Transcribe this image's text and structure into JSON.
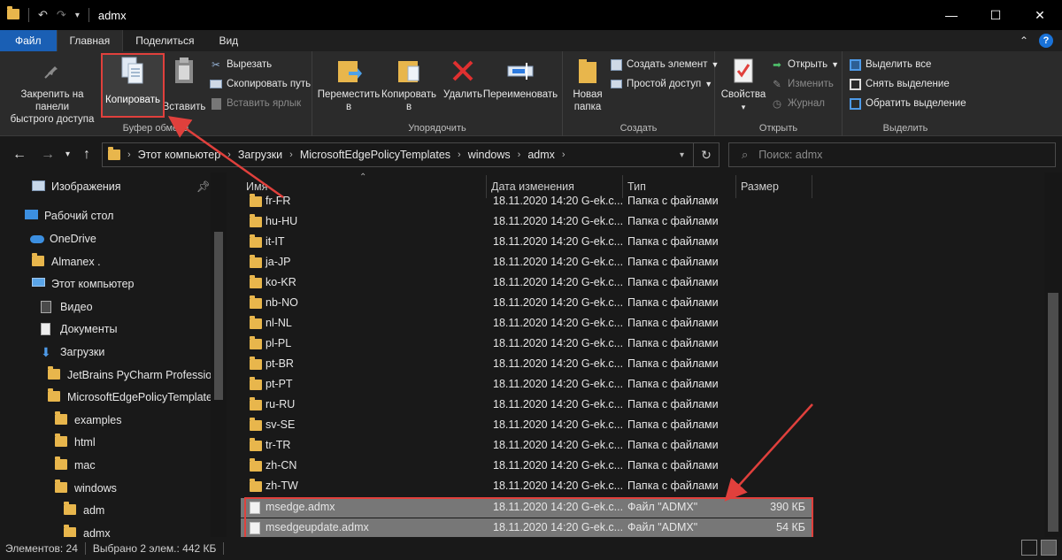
{
  "window": {
    "title": "admx"
  },
  "tabs": [
    {
      "label": "Файл"
    },
    {
      "label": "Главная"
    },
    {
      "label": "Поделиться"
    },
    {
      "label": "Вид"
    }
  ],
  "ribbon": {
    "clipboard": {
      "pin_label_1": "Закрепить на панели",
      "pin_label_2": "быстрого доступа",
      "copy": "Копировать",
      "paste": "Вставить",
      "cut": "Вырезать",
      "copy_path": "Скопировать путь",
      "paste_shortcut": "Вставить ярлык",
      "group": "Буфер обмена"
    },
    "organize": {
      "move_1": "Переместить",
      "move_2": "в",
      "copy_1": "Копировать",
      "copy_2": "в",
      "delete": "Удалить",
      "rename": "Переименовать",
      "group": "Упорядочить"
    },
    "create": {
      "new_folder_1": "Новая",
      "new_folder_2": "папка",
      "new_item": "Создать элемент",
      "easy_access": "Простой доступ",
      "group": "Создать"
    },
    "open": {
      "properties": "Свойства",
      "open": "Открыть",
      "edit": "Изменить",
      "history": "Журнал",
      "group": "Открыть"
    },
    "select": {
      "select_all": "Выделить все",
      "select_none": "Снять выделение",
      "invert": "Обратить выделение",
      "group": "Выделить"
    }
  },
  "address": {
    "crumbs": [
      "Этот компьютер",
      "Загрузки",
      "MicrosoftEdgePolicyTemplates",
      "windows",
      "admx"
    ],
    "search_placeholder": "Поиск: admx"
  },
  "nav_pane": {
    "items": [
      "Изображения",
      "Рабочий стол",
      "OneDrive",
      "Almanex .",
      "Этот компьютер",
      "Видео",
      "Документы",
      "Загрузки",
      "JetBrains PyCharm Profession",
      "MicrosoftEdgePolicyTemplate",
      "examples",
      "html",
      "mac",
      "windows",
      "adm",
      "admx"
    ]
  },
  "columns": {
    "name": "Имя",
    "date": "Дата изменения",
    "type": "Тип",
    "size": "Размер"
  },
  "files": [
    {
      "name": "fr-FR",
      "date": "18.11.2020 14:20 G-ek.c...",
      "type": "Папка с файлами",
      "size": ""
    },
    {
      "name": "hu-HU",
      "date": "18.11.2020 14:20 G-ek.c...",
      "type": "Папка с файлами",
      "size": ""
    },
    {
      "name": "it-IT",
      "date": "18.11.2020 14:20 G-ek.c...",
      "type": "Папка с файлами",
      "size": ""
    },
    {
      "name": "ja-JP",
      "date": "18.11.2020 14:20 G-ek.c...",
      "type": "Папка с файлами",
      "size": ""
    },
    {
      "name": "ko-KR",
      "date": "18.11.2020 14:20 G-ek.c...",
      "type": "Папка с файлами",
      "size": ""
    },
    {
      "name": "nb-NO",
      "date": "18.11.2020 14:20 G-ek.c...",
      "type": "Папка с файлами",
      "size": ""
    },
    {
      "name": "nl-NL",
      "date": "18.11.2020 14:20 G-ek.c...",
      "type": "Папка с файлами",
      "size": ""
    },
    {
      "name": "pl-PL",
      "date": "18.11.2020 14:20 G-ek.c...",
      "type": "Папка с файлами",
      "size": ""
    },
    {
      "name": "pt-BR",
      "date": "18.11.2020 14:20 G-ek.c...",
      "type": "Папка с файлами",
      "size": ""
    },
    {
      "name": "pt-PT",
      "date": "18.11.2020 14:20 G-ek.c...",
      "type": "Папка с файлами",
      "size": ""
    },
    {
      "name": "ru-RU",
      "date": "18.11.2020 14:20 G-ek.c...",
      "type": "Папка с файлами",
      "size": ""
    },
    {
      "name": "sv-SE",
      "date": "18.11.2020 14:20 G-ek.c...",
      "type": "Папка с файлами",
      "size": ""
    },
    {
      "name": "tr-TR",
      "date": "18.11.2020 14:20 G-ek.c...",
      "type": "Папка с файлами",
      "size": ""
    },
    {
      "name": "zh-CN",
      "date": "18.11.2020 14:20 G-ek.c...",
      "type": "Папка с файлами",
      "size": ""
    },
    {
      "name": "zh-TW",
      "date": "18.11.2020 14:20 G-ek.c...",
      "type": "Папка с файлами",
      "size": ""
    },
    {
      "name": "msedge.admx",
      "date": "18.11.2020 14:20 G-ek.c...",
      "type": "Файл \"ADMX\"",
      "size": "390 КБ"
    },
    {
      "name": "msedgeupdate.admx",
      "date": "18.11.2020 14:20 G-ek.c...",
      "type": "Файл \"ADMX\"",
      "size": "54 КБ"
    }
  ],
  "status": {
    "items": "Элементов: 24",
    "selected": "Выбрано 2 элем.: 442 КБ"
  },
  "colors": {
    "accent": "#1a5fb4",
    "annotation": "#e0403c",
    "folder": "#e8b64c"
  }
}
